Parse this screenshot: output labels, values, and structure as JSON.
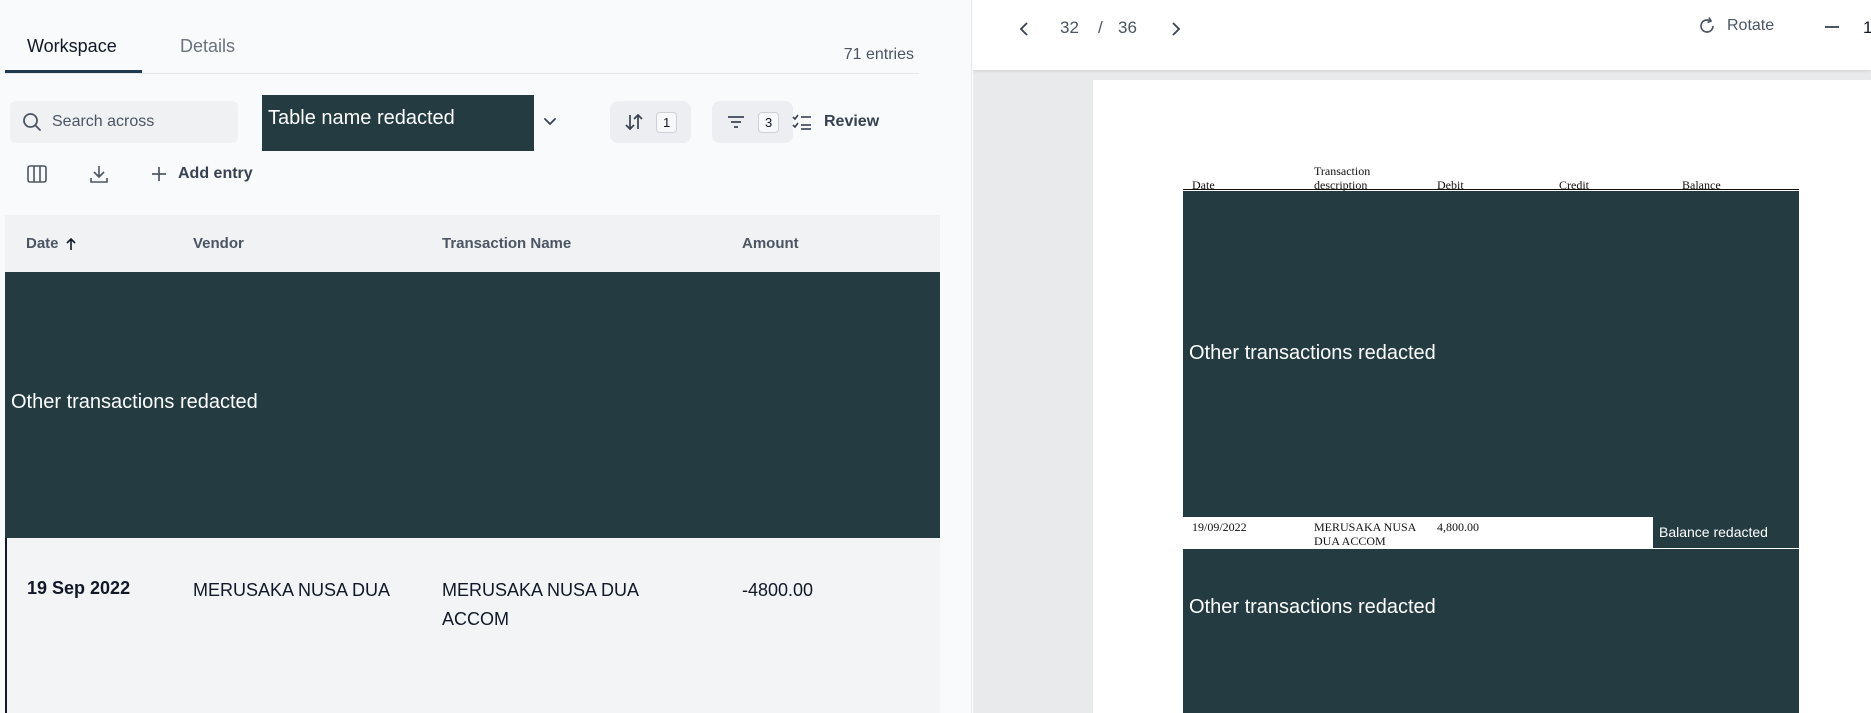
{
  "tabs": [
    {
      "label": "Workspace",
      "active": true
    },
    {
      "label": "Details",
      "active": false
    }
  ],
  "entries_count": "71 entries",
  "search": {
    "placeholder": "Search across"
  },
  "table_select": {
    "value": "Table name redacted"
  },
  "sort": {
    "count": "1"
  },
  "filter": {
    "count": "3"
  },
  "review_label": "Review",
  "add_entry_label": "Add entry",
  "columns": [
    "Date",
    "Vendor",
    "Transaction Name",
    "Amount"
  ],
  "redacted_left": "Other transactions redacted",
  "selected_row": {
    "date": "19 Sep 2022",
    "vendor": "MERUSAKA NUSA DUA",
    "transaction_name": "MERUSAKA NUSA DUA ACCOM",
    "amount": "-4800.00"
  },
  "viewer": {
    "page_current": "32",
    "page_separator": "/",
    "page_total": "36",
    "rotate_label": "Rotate",
    "zoom_partial": "1"
  },
  "pdf": {
    "headers": {
      "date": "Date",
      "description": "Transaction description",
      "debit": "Debit",
      "credit": "Credit",
      "balance": "Balance"
    },
    "redacted_top": "Other transactions redacted",
    "row": {
      "date": "19/09/2022",
      "description": "MERUSAKA NUSA DUA ACCOM",
      "debit": "4,800.00",
      "balance_redacted": "Balance redacted"
    },
    "redacted_bottom": "Other transactions redacted"
  },
  "colors": {
    "redaction": "#233b41",
    "accent": "#1f3a4d"
  }
}
